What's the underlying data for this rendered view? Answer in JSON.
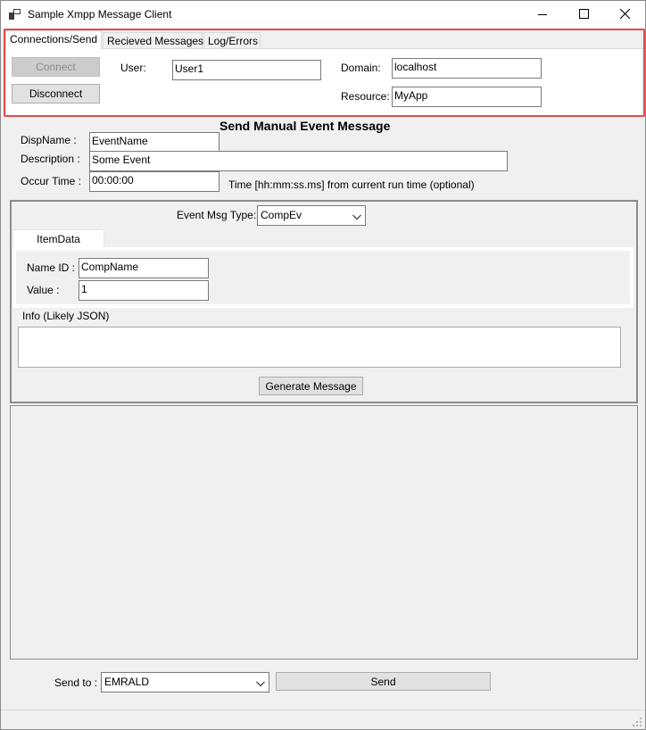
{
  "window": {
    "title": "Sample Xmpp Message Client"
  },
  "tabs": [
    {
      "label": "Connections/Send",
      "active": true
    },
    {
      "label": "Recieved Messages",
      "active": false
    },
    {
      "label": "Log/Errors",
      "active": false
    }
  ],
  "connection": {
    "connect_label": "Connect",
    "disconnect_label": "Disconnect",
    "user_label": "User:",
    "user_value": "User1",
    "domain_label": "Domain:",
    "domain_value": "localhost",
    "resource_label": "Resource:",
    "resource_value": "MyApp"
  },
  "send_section": {
    "heading": "Send Manual Event Message",
    "dispname_label": "DispName :",
    "dispname_value": "EventName",
    "description_label": "Description :",
    "description_value": "Some Event",
    "occur_label": "Occur Time :",
    "occur_value": "00:00:00",
    "occur_hint": "Time [hh:mm:ss.ms] from current run time (optional)"
  },
  "event_group": {
    "type_label": "Event Msg Type:",
    "type_value": "CompEv",
    "inner_tab": "ItemData",
    "nameid_label": "Name ID :",
    "nameid_value": "CompName",
    "value_label": "Value :",
    "value_value": "1",
    "info_label": "Info (Likely JSON)",
    "info_value": "",
    "generate_label": "Generate Message"
  },
  "footer": {
    "sendto_label": "Send to :",
    "sendto_value": "EMRALD",
    "send_label": "Send"
  },
  "colors": {
    "highlight": "#e8484e",
    "button_face": "#e1e1e1"
  }
}
